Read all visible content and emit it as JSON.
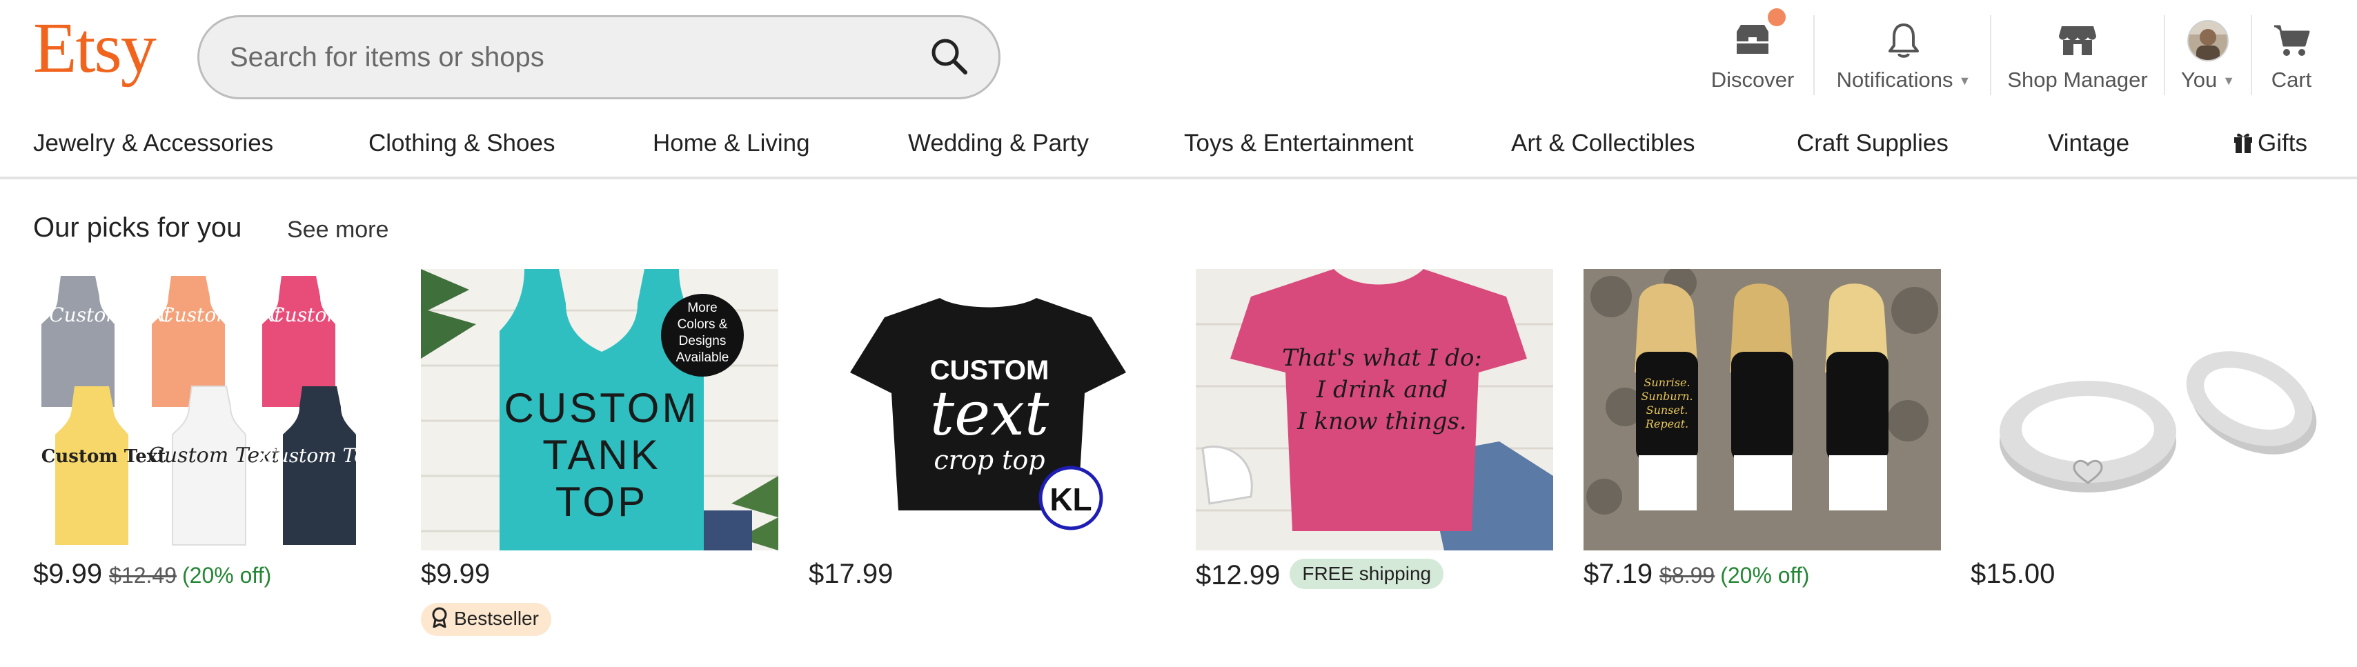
{
  "header": {
    "logo": "Etsy",
    "search": {
      "placeholder": "Search for items or shops",
      "value": ""
    },
    "nav": [
      {
        "label": "Discover",
        "icon": "discover-icon"
      },
      {
        "label": "Notifications",
        "icon": "bell-icon"
      },
      {
        "label": "Shop Manager",
        "icon": "shop-icon"
      },
      {
        "label": "You",
        "icon": "avatar"
      },
      {
        "label": "Cart",
        "icon": "cart-icon"
      }
    ],
    "colors": {
      "brand": "#F1641E",
      "notification_dot": "#F2895E"
    }
  },
  "categories": [
    "Jewelry & Accessories",
    "Clothing & Shoes",
    "Home & Living",
    "Wedding & Party",
    "Toys & Entertainment",
    "Art & Collectibles",
    "Craft Supplies",
    "Vintage",
    "Gifts"
  ],
  "section": {
    "title": "Our picks for you",
    "see_more": "See more"
  },
  "products": [
    {
      "price": "$9.99",
      "original_price": "$12.49",
      "discount": "(20% off)",
      "image_text": [
        "Custom Text",
        "Custom Text",
        "Custom Text",
        "Custom Text",
        "Custom Text",
        "Custom Text"
      ]
    },
    {
      "price": "$9.99",
      "badge": "Bestseller",
      "image_text": {
        "main": [
          "CUSTOM",
          "TANK",
          "TOP"
        ],
        "sticker": [
          "More",
          "Colors &",
          "Designs",
          "Available"
        ]
      }
    },
    {
      "price": "$17.99",
      "image_text": {
        "top": "CUSTOM",
        "middle": "text",
        "bottom": "crop top",
        "logo": "KL"
      }
    },
    {
      "price": "$12.99",
      "shipping": "FREE shipping",
      "image_text": [
        "That's what I do:",
        "I drink and",
        "I know things."
      ]
    },
    {
      "price": "$7.19",
      "original_price": "$8.99",
      "discount": "(20% off)",
      "image_text": [
        "Sunrise.",
        "Sunburn.",
        "Sunset.",
        "Repeat."
      ]
    },
    {
      "price": "$15.00"
    }
  ]
}
